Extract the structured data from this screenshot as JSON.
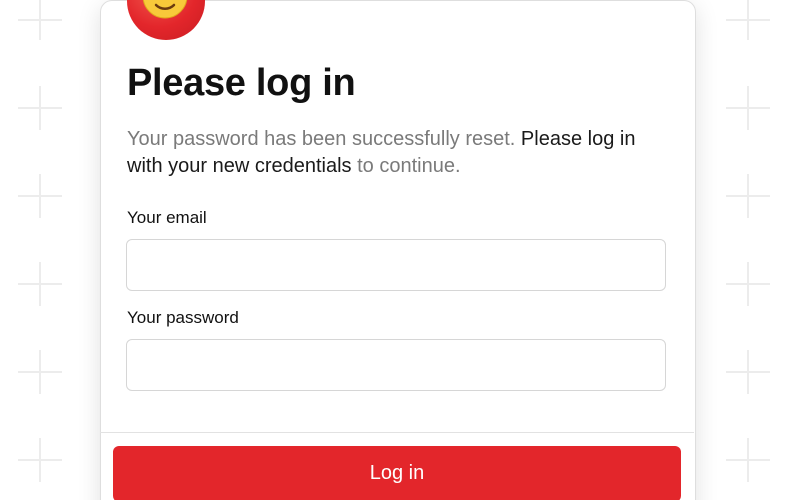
{
  "colors": {
    "accent": "#e3262b",
    "text_primary": "#111111",
    "text_muted": "#7a7a7a",
    "input_border": "#d6d6d6",
    "background_pattern": "#eeeeee"
  },
  "avatar": {
    "icon": "smiling-face-with-sunglasses-icon"
  },
  "login": {
    "title": "Please log in",
    "message": {
      "part1": "Your password has been successfully reset. ",
      "part2": "Please log in with your new credentials",
      "part3": " to continue."
    },
    "email_label": "Your email",
    "email_value": "",
    "email_placeholder": "",
    "password_label": "Your password",
    "password_value": "",
    "password_placeholder": "",
    "submit_label": "Log in"
  }
}
